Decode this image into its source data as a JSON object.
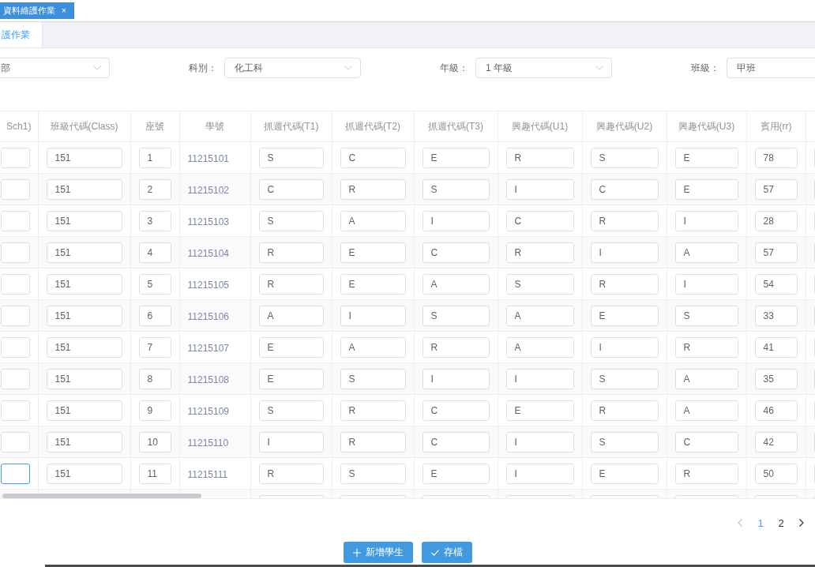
{
  "top_tabs": [
    {
      "label": "資料維護作業",
      "close": "×",
      "selected": true
    }
  ],
  "inner_tabs": [
    {
      "label": "護作業",
      "selected": true
    }
  ],
  "filters": [
    {
      "value": "部",
      "cut_left": true
    },
    {
      "label": "科別：",
      "value": "化工科"
    },
    {
      "label": "年級：",
      "value": "1 年級"
    },
    {
      "label": "班級：",
      "value": "甲班",
      "cut_right": true
    }
  ],
  "table": {
    "columns": [
      {
        "label": "Sch1)",
        "kind": "input"
      },
      {
        "label": "班級代碼(Class)",
        "kind": "input"
      },
      {
        "label": "座號",
        "kind": "input"
      },
      {
        "label": "學號",
        "kind": "text"
      },
      {
        "label": "抓週代碼(T1)",
        "kind": "input"
      },
      {
        "label": "抓週代碼(T2)",
        "kind": "input"
      },
      {
        "label": "抓週代碼(T3)",
        "kind": "input"
      },
      {
        "label": "興趣代碼(U1)",
        "kind": "input"
      },
      {
        "label": "興趣代碼(U2)",
        "kind": "input"
      },
      {
        "label": "興趣代碼(U3)",
        "kind": "input"
      },
      {
        "label": "賓用(rr)",
        "kind": "input"
      },
      {
        "kind": "input"
      }
    ],
    "rows": [
      {
        "focused": false,
        "cells": [
          "",
          "151",
          "1",
          "11215101",
          "S",
          "C",
          "E",
          "R",
          "S",
          "E",
          "78",
          ""
        ]
      },
      {
        "focused": false,
        "cells": [
          "",
          "151",
          "2",
          "11215102",
          "C",
          "R",
          "S",
          "I",
          "C",
          "E",
          "57",
          ""
        ]
      },
      {
        "focused": false,
        "cells": [
          "",
          "151",
          "3",
          "11215103",
          "S",
          "A",
          "I",
          "C",
          "R",
          "I",
          "28",
          ""
        ]
      },
      {
        "focused": false,
        "cells": [
          "",
          "151",
          "4",
          "11215104",
          "R",
          "E",
          "C",
          "R",
          "I",
          "A",
          "57",
          ""
        ]
      },
      {
        "focused": false,
        "cells": [
          "",
          "151",
          "5",
          "11215105",
          "R",
          "E",
          "A",
          "S",
          "R",
          "I",
          "54",
          ""
        ]
      },
      {
        "focused": false,
        "cells": [
          "",
          "151",
          "6",
          "11215106",
          "A",
          "I",
          "S",
          "A",
          "E",
          "S",
          "33",
          ""
        ]
      },
      {
        "focused": false,
        "cells": [
          "",
          "151",
          "7",
          "11215107",
          "E",
          "A",
          "R",
          "A",
          "I",
          "R",
          "41",
          ""
        ]
      },
      {
        "focused": false,
        "cells": [
          "",
          "151",
          "8",
          "11215108",
          "E",
          "S",
          "I",
          "I",
          "S",
          "A",
          "35",
          ""
        ]
      },
      {
        "focused": false,
        "cells": [
          "",
          "151",
          "9",
          "11215109",
          "S",
          "R",
          "C",
          "E",
          "R",
          "A",
          "46",
          ""
        ]
      },
      {
        "focused": false,
        "cells": [
          "",
          "151",
          "10",
          "11215110",
          "I",
          "R",
          "C",
          "I",
          "S",
          "C",
          "42",
          ""
        ]
      },
      {
        "focused": true,
        "cells": [
          "",
          "151",
          "11",
          "11215111",
          "R",
          "S",
          "E",
          "I",
          "E",
          "R",
          "50",
          ""
        ]
      }
    ],
    "more_rows_below": true
  },
  "pagination": {
    "prev_disabled": true,
    "pages": [
      {
        "label": "1",
        "selected": true
      },
      {
        "label": "2",
        "selected": false
      }
    ],
    "next_disabled": false
  },
  "buttons": [
    {
      "label": "新增學生",
      "kind": "add"
    },
    {
      "label": "存檔",
      "kind": "save"
    }
  ]
}
